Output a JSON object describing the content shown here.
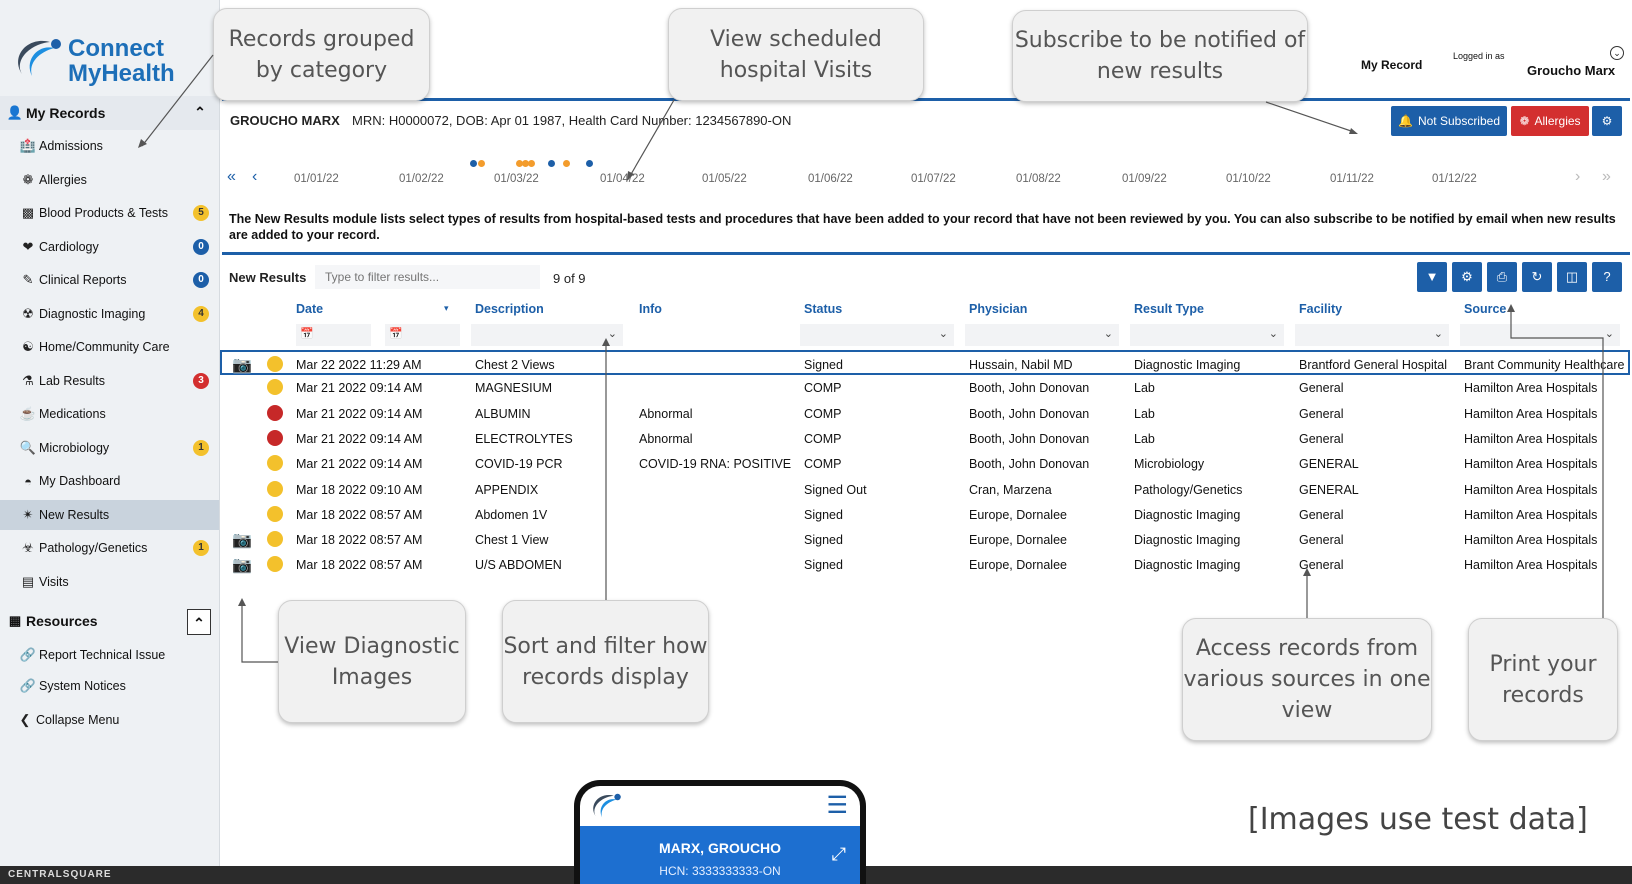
{
  "app": {
    "brand_line1": "Connect",
    "brand_line2": "MyHealth"
  },
  "top": {
    "my_record": "My Record",
    "logged_in_as": "Logged in as",
    "user": "Groucho Marx"
  },
  "sidebar": {
    "my_records": "My Records",
    "items": [
      {
        "label": "Admissions",
        "badge": "",
        "icon": "hospital-icon"
      },
      {
        "label": "Allergies",
        "badge": "",
        "icon": "allergy-icon"
      },
      {
        "label": "Blood Products & Tests",
        "badge": "5",
        "icon": "blood-bag-icon"
      },
      {
        "label": "Cardiology",
        "badge": "0",
        "icon": "heart-icon"
      },
      {
        "label": "Clinical Reports",
        "badge": "0",
        "icon": "report-edit-icon"
      },
      {
        "label": "Diagnostic Imaging",
        "badge": "4",
        "icon": "radiation-icon"
      },
      {
        "label": "Home/Community Care",
        "badge": "",
        "icon": "community-care-icon"
      },
      {
        "label": "Lab Results",
        "badge": "3",
        "icon": "flask-icon"
      },
      {
        "label": "Medications",
        "badge": "",
        "icon": "mortar-icon"
      },
      {
        "label": "Microbiology",
        "badge": "1",
        "icon": "microscope-icon"
      },
      {
        "label": "My Dashboard",
        "badge": "",
        "icon": "dashboard-icon"
      },
      {
        "label": "New Results",
        "badge": "",
        "icon": "new-results-icon"
      },
      {
        "label": "Pathology/Genetics",
        "badge": "1",
        "icon": "biohazard-icon"
      },
      {
        "label": "Visits",
        "badge": "",
        "icon": "chart-icon"
      }
    ],
    "resources": "Resources",
    "resource_items": [
      {
        "label": "Report Technical Issue",
        "icon": "link-icon"
      },
      {
        "label": "System Notices",
        "icon": "link-icon"
      }
    ],
    "collapse": "Collapse Menu"
  },
  "patient": {
    "name": "GROUCHO MARX",
    "info": "MRN: H0000072, DOB: Apr 01 1987, Health Card Number: 1234567890-ON",
    "not_subscribed": "Not Subscribed",
    "allergies": "Allergies"
  },
  "timeline": {
    "dates": [
      "01/01/22",
      "01/02/22",
      "01/03/22",
      "01/04/22",
      "01/05/22",
      "01/06/22",
      "01/07/22",
      "01/08/22",
      "01/09/22",
      "01/10/22",
      "01/11/22",
      "01/12/22"
    ]
  },
  "module": {
    "description": "The New Results module lists select types of results from hospital-based tests and procedures that have been added to your record that have not been reviewed by you. You can also subscribe to be notified by email when new results are added to your record."
  },
  "grid": {
    "title": "New Results",
    "filter_placeholder": "Type to filter results...",
    "count": "9 of 9",
    "columns": [
      "Date",
      "Description",
      "Info",
      "Status",
      "Physician",
      "Result Type",
      "Facility",
      "Source"
    ],
    "rows": [
      {
        "cam": true,
        "dot": "#f3c12c",
        "date": "Mar 22 2022 11:29 AM",
        "desc": "Chest 2 Views",
        "info": "",
        "status": "Signed",
        "physician": "Hussain, Nabil MD",
        "type": "Diagnostic Imaging",
        "facility": "Brantford General Hospital",
        "source": "Brant Community Healthcare"
      },
      {
        "cam": false,
        "dot": "#f3c12c",
        "date": "Mar 21 2022 09:14 AM",
        "desc": "MAGNESIUM",
        "info": "",
        "status": "COMP",
        "physician": "Booth, John Donovan",
        "type": "Lab",
        "facility": "General",
        "source": "Hamilton Area Hospitals"
      },
      {
        "cam": false,
        "dot": "#c62828",
        "date": "Mar 21 2022 09:14 AM",
        "desc": "ALBUMIN",
        "info": "Abnormal",
        "status": "COMP",
        "physician": "Booth, John Donovan",
        "type": "Lab",
        "facility": "General",
        "source": "Hamilton Area Hospitals"
      },
      {
        "cam": false,
        "dot": "#c62828",
        "date": "Mar 21 2022 09:14 AM",
        "desc": "ELECTROLYTES",
        "info": "Abnormal",
        "status": "COMP",
        "physician": "Booth, John Donovan",
        "type": "Lab",
        "facility": "General",
        "source": "Hamilton Area Hospitals"
      },
      {
        "cam": false,
        "dot": "#f3c12c",
        "date": "Mar 21 2022 09:14 AM",
        "desc": "COVID-19 PCR",
        "info": "COVID-19 RNA: POSITIVE",
        "status": "COMP",
        "physician": "Booth, John Donovan",
        "type": "Microbiology",
        "facility": "GENERAL",
        "source": "Hamilton Area Hospitals"
      },
      {
        "cam": false,
        "dot": "#f3c12c",
        "date": "Mar 18 2022 09:10 AM",
        "desc": "APPENDIX",
        "info": "",
        "status": "Signed Out",
        "physician": "Cran, Marzena",
        "type": "Pathology/Genetics",
        "facility": "GENERAL",
        "source": "Hamilton Area Hospitals"
      },
      {
        "cam": false,
        "dot": "#f3c12c",
        "date": "Mar 18 2022 08:57 AM",
        "desc": "Abdomen 1V",
        "info": "",
        "status": "Signed",
        "physician": "Europe, Dornalee",
        "type": "Diagnostic Imaging",
        "facility": "General",
        "source": "Hamilton Area Hospitals"
      },
      {
        "cam": true,
        "dot": "#f3c12c",
        "date": "Mar 18 2022 08:57 AM",
        "desc": "Chest 1 View",
        "info": "",
        "status": "Signed",
        "physician": "Europe, Dornalee",
        "type": "Diagnostic Imaging",
        "facility": "General",
        "source": "Hamilton Area Hospitals"
      },
      {
        "cam": true,
        "dot": "#f3c12c",
        "date": "Mar 18 2022 08:57 AM",
        "desc": "U/S ABDOMEN",
        "info": "",
        "status": "Signed",
        "physician": "Europe, Dornalee",
        "type": "Diagnostic Imaging",
        "facility": "General",
        "source": "Hamilton Area Hospitals"
      }
    ]
  },
  "callouts": {
    "grouped": "Records grouped by category",
    "visits": "View scheduled hospital Visits",
    "subscribe": "Subscribe to be notified of new results",
    "diag": "View Diagnostic Images",
    "sort": "Sort and filter how records display",
    "access": "Access records from various sources in one view",
    "print": "Print your records"
  },
  "note": "[Images use test data]",
  "footer": {
    "brand": "CENTRALSQUARE"
  },
  "phone": {
    "name": "MARX, GROUCHO",
    "hcn": "HCN: 3333333333-ON"
  },
  "colors": {
    "accent": "#1d5fa8",
    "danger": "#d32f2f",
    "warning": "#f3c12c"
  }
}
